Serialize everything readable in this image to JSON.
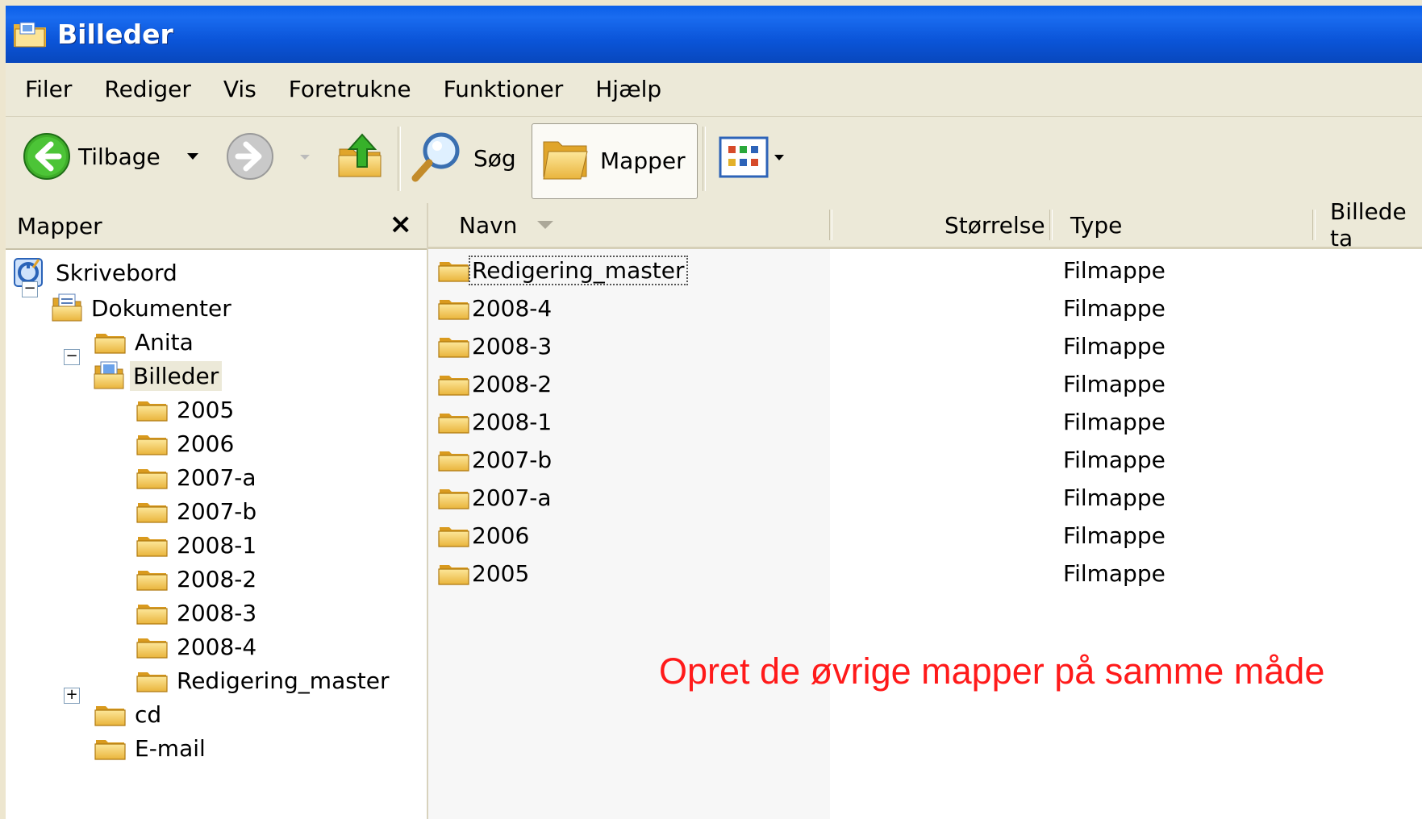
{
  "window": {
    "title": "Billeder"
  },
  "menubar": {
    "items": [
      "Filer",
      "Rediger",
      "Vis",
      "Foretrukne",
      "Funktioner",
      "Hjælp"
    ]
  },
  "toolbar": {
    "back_label": "Tilbage",
    "search_label": "Søg",
    "folders_label": "Mapper"
  },
  "folder_pane": {
    "header": "Mapper",
    "close_glyph": "×",
    "tree": [
      {
        "label": "Skrivebord",
        "icon": "desktop-icon",
        "level": 0
      },
      {
        "label": "Dokumenter",
        "icon": "documents-icon",
        "level": 1,
        "expander": "⊟"
      },
      {
        "label": "Anita",
        "icon": "folder-icon",
        "level": 2
      },
      {
        "label": "Billeder",
        "icon": "pictures-folder-icon",
        "level": 2,
        "expander": "⊟",
        "selected": true
      },
      {
        "label": "2005",
        "icon": "folder-icon",
        "level": 3
      },
      {
        "label": "2006",
        "icon": "folder-icon",
        "level": 3
      },
      {
        "label": "2007-a",
        "icon": "folder-icon",
        "level": 3
      },
      {
        "label": "2007-b",
        "icon": "folder-icon",
        "level": 3
      },
      {
        "label": "2008-1",
        "icon": "folder-icon",
        "level": 3
      },
      {
        "label": "2008-2",
        "icon": "folder-icon",
        "level": 3
      },
      {
        "label": "2008-3",
        "icon": "folder-icon",
        "level": 3
      },
      {
        "label": "2008-4",
        "icon": "folder-icon",
        "level": 3
      },
      {
        "label": "Redigering_master",
        "icon": "folder-icon",
        "level": 3
      },
      {
        "label": "cd",
        "icon": "folder-icon",
        "level": 2,
        "expander": "⊞"
      },
      {
        "label": "E-mail",
        "icon": "folder-icon",
        "level": 2
      }
    ]
  },
  "file_list": {
    "columns": [
      "Navn",
      "Størrelse",
      "Type",
      "Billede ta"
    ],
    "rows": [
      {
        "name": "Redigering_master",
        "type": "Filmappe",
        "focused": true
      },
      {
        "name": "2008-4",
        "type": "Filmappe"
      },
      {
        "name": "2008-3",
        "type": "Filmappe"
      },
      {
        "name": "2008-2",
        "type": "Filmappe"
      },
      {
        "name": "2008-1",
        "type": "Filmappe"
      },
      {
        "name": "2007-b",
        "type": "Filmappe"
      },
      {
        "name": "2007-a",
        "type": "Filmappe"
      },
      {
        "name": "2006",
        "type": "Filmappe"
      },
      {
        "name": "2005",
        "type": "Filmappe"
      }
    ]
  },
  "annotation": "Opret de øvrige mapper på samme måde",
  "colors": {
    "titlebar": "#0a5ee8",
    "annotation": "#ff1a1a",
    "chrome": "#ece9d8"
  }
}
